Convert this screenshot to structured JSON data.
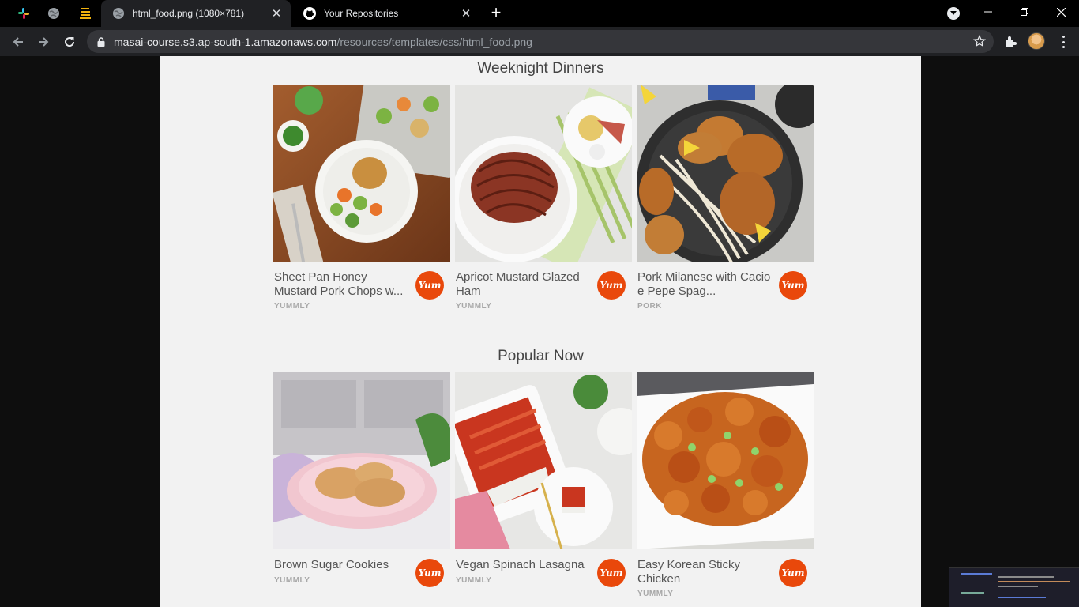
{
  "browser": {
    "tabs": [
      {
        "title": "html_food.png (1080×781)",
        "active": true
      },
      {
        "title": "Your Repositories",
        "active": false
      }
    ],
    "new_tab_label": "+",
    "url_host": "masai-course.s3.ap-south-1.amazonaws.com",
    "url_path": "/resources/templates/css/html_food.png"
  },
  "sections": [
    {
      "title": "Weeknight Dinners",
      "cards": [
        {
          "name": "Sheet Pan Honey Mustard Pork Chops w...",
          "source": "YUMMLY",
          "badge": "Yum"
        },
        {
          "name": "Apricot Mustard Glazed Ham",
          "source": "YUMMLY",
          "badge": "Yum"
        },
        {
          "name": "Pork Milanese with Cacio e Pepe Spag...",
          "source": "PORK",
          "badge": "Yum"
        }
      ]
    },
    {
      "title": "Popular Now",
      "cards": [
        {
          "name": "Brown Sugar Cookies",
          "source": "YUMMLY",
          "badge": "Yum"
        },
        {
          "name": "Vegan Spinach Lasagna",
          "source": "YUMMLY",
          "badge": "Yum"
        },
        {
          "name": "Easy Korean Sticky Chicken",
          "source": "YUMMLY",
          "badge": "Yum"
        }
      ]
    }
  ],
  "colors": {
    "page_bg": "#f2f2f2",
    "yum_badge": "#e9480b",
    "chrome_bg": "#202124",
    "tabstrip_bg": "#000000"
  }
}
